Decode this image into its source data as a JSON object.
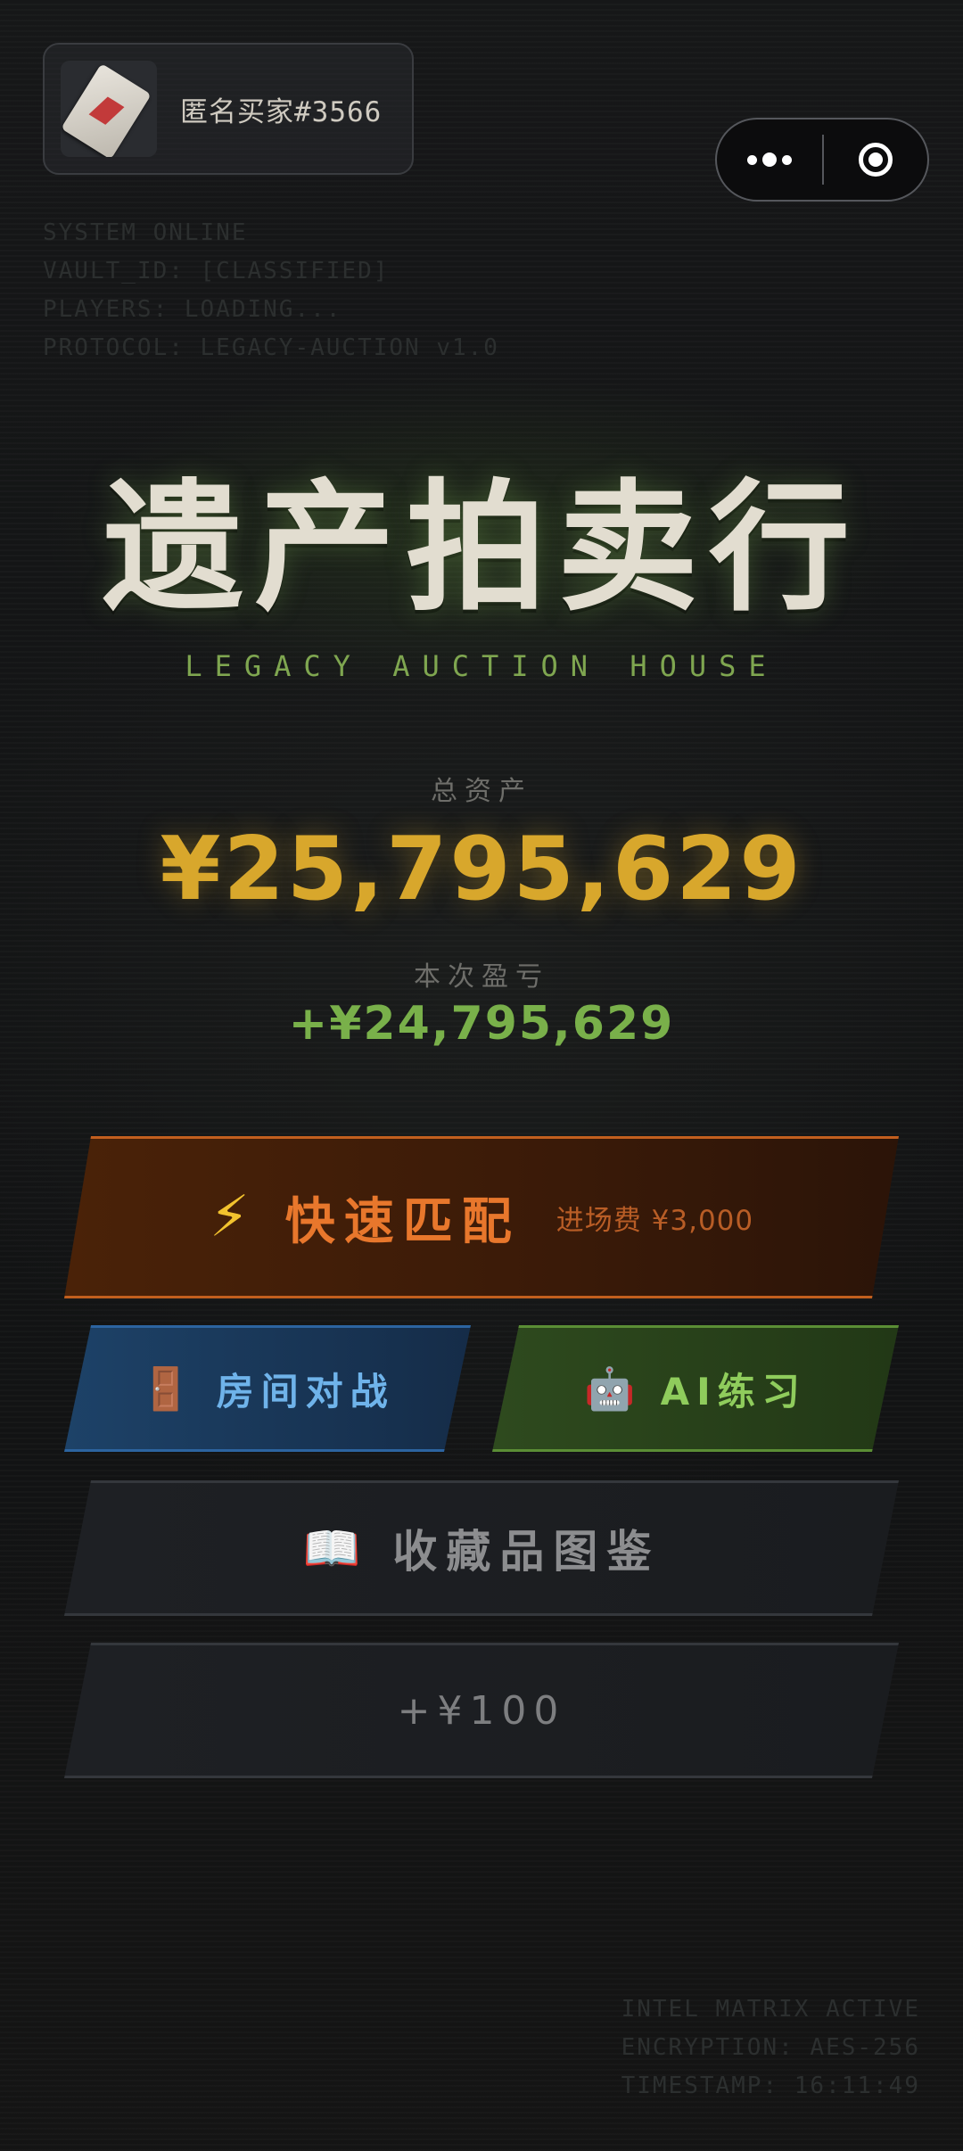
{
  "player": {
    "name": "匿名买家#3566",
    "avatar_icon": "playing-card-icon"
  },
  "capsule": {
    "more_icon": "more-dots-icon",
    "target_icon": "target-icon"
  },
  "system": {
    "lines": [
      "SYSTEM ONLINE",
      "VAULT_ID: [CLASSIFIED]",
      "PLAYERS: LOADING...",
      "PROTOCOL: LEGACY-AUCTION v1.0"
    ]
  },
  "title": {
    "main": "遗产拍卖行",
    "sub": "LEGACY AUCTION HOUSE"
  },
  "assets": {
    "label": "总资产",
    "value": "¥25,795,629",
    "pl_label": "本次盈亏",
    "pl_value": "+¥24,795,629"
  },
  "buttons": {
    "quick_match": {
      "icon": "⚡",
      "label": "快速匹配",
      "fee": "进场费 ¥3,000"
    },
    "room_battle": {
      "icon": "🚪",
      "label": "房间对战"
    },
    "ai_practice": {
      "icon": "🤖",
      "label": "AI练习"
    },
    "collection": {
      "icon": "📖",
      "label": "收藏品图鉴"
    },
    "bonus": {
      "label": "+¥100"
    }
  },
  "intel": {
    "lines": [
      "INTEL MATRIX ACTIVE",
      "ENCRYPTION: AES-256",
      "TIMESTAMP: 16:11:49"
    ]
  },
  "colors": {
    "gold": "#d8a72c",
    "profit_green": "#79b04a",
    "quick_orange": "#e8772c",
    "room_blue": "#6fb3ea",
    "ai_green": "#8fcc5c"
  }
}
